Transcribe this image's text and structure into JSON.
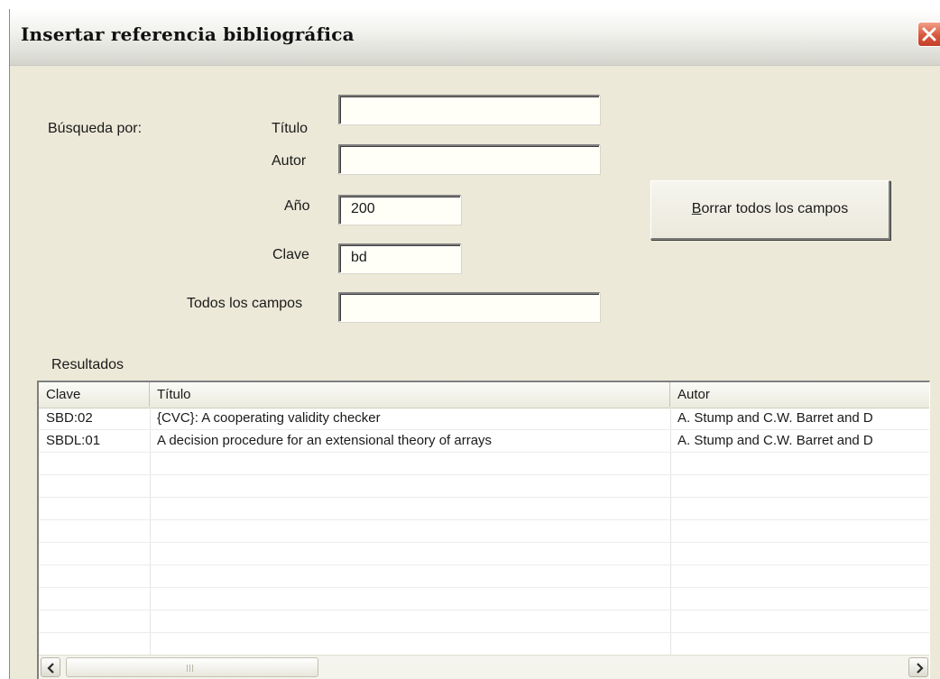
{
  "window": {
    "title": "Insertar referencia bibliográfica"
  },
  "search": {
    "label": "Búsqueda por:",
    "titulo_label": "Título",
    "titulo_value": "",
    "autor_label": "Autor",
    "autor_value": "",
    "anio_label": "Año",
    "anio_value": "200",
    "clave_label": "Clave",
    "clave_value": "bd",
    "todos_label": "Todos los campos",
    "todos_value": ""
  },
  "buttons": {
    "clear_first_letter": "B",
    "clear_rest": "orrar todos los campos"
  },
  "results": {
    "label": "Resultados",
    "columns": [
      "Clave",
      "Título",
      "Autor"
    ],
    "rows": [
      [
        "SBD:02",
        "{CVC}: A cooperating validity checker",
        "A. Stump and C.W. Barret and D"
      ],
      [
        "SBDL:01",
        "A decision procedure for an extensional theory of arrays",
        "A. Stump and C.W. Barret and D"
      ]
    ]
  },
  "icons": {
    "close": "close-icon",
    "scroll_left": "arrow-left-icon",
    "scroll_right": "arrow-right-icon"
  }
}
